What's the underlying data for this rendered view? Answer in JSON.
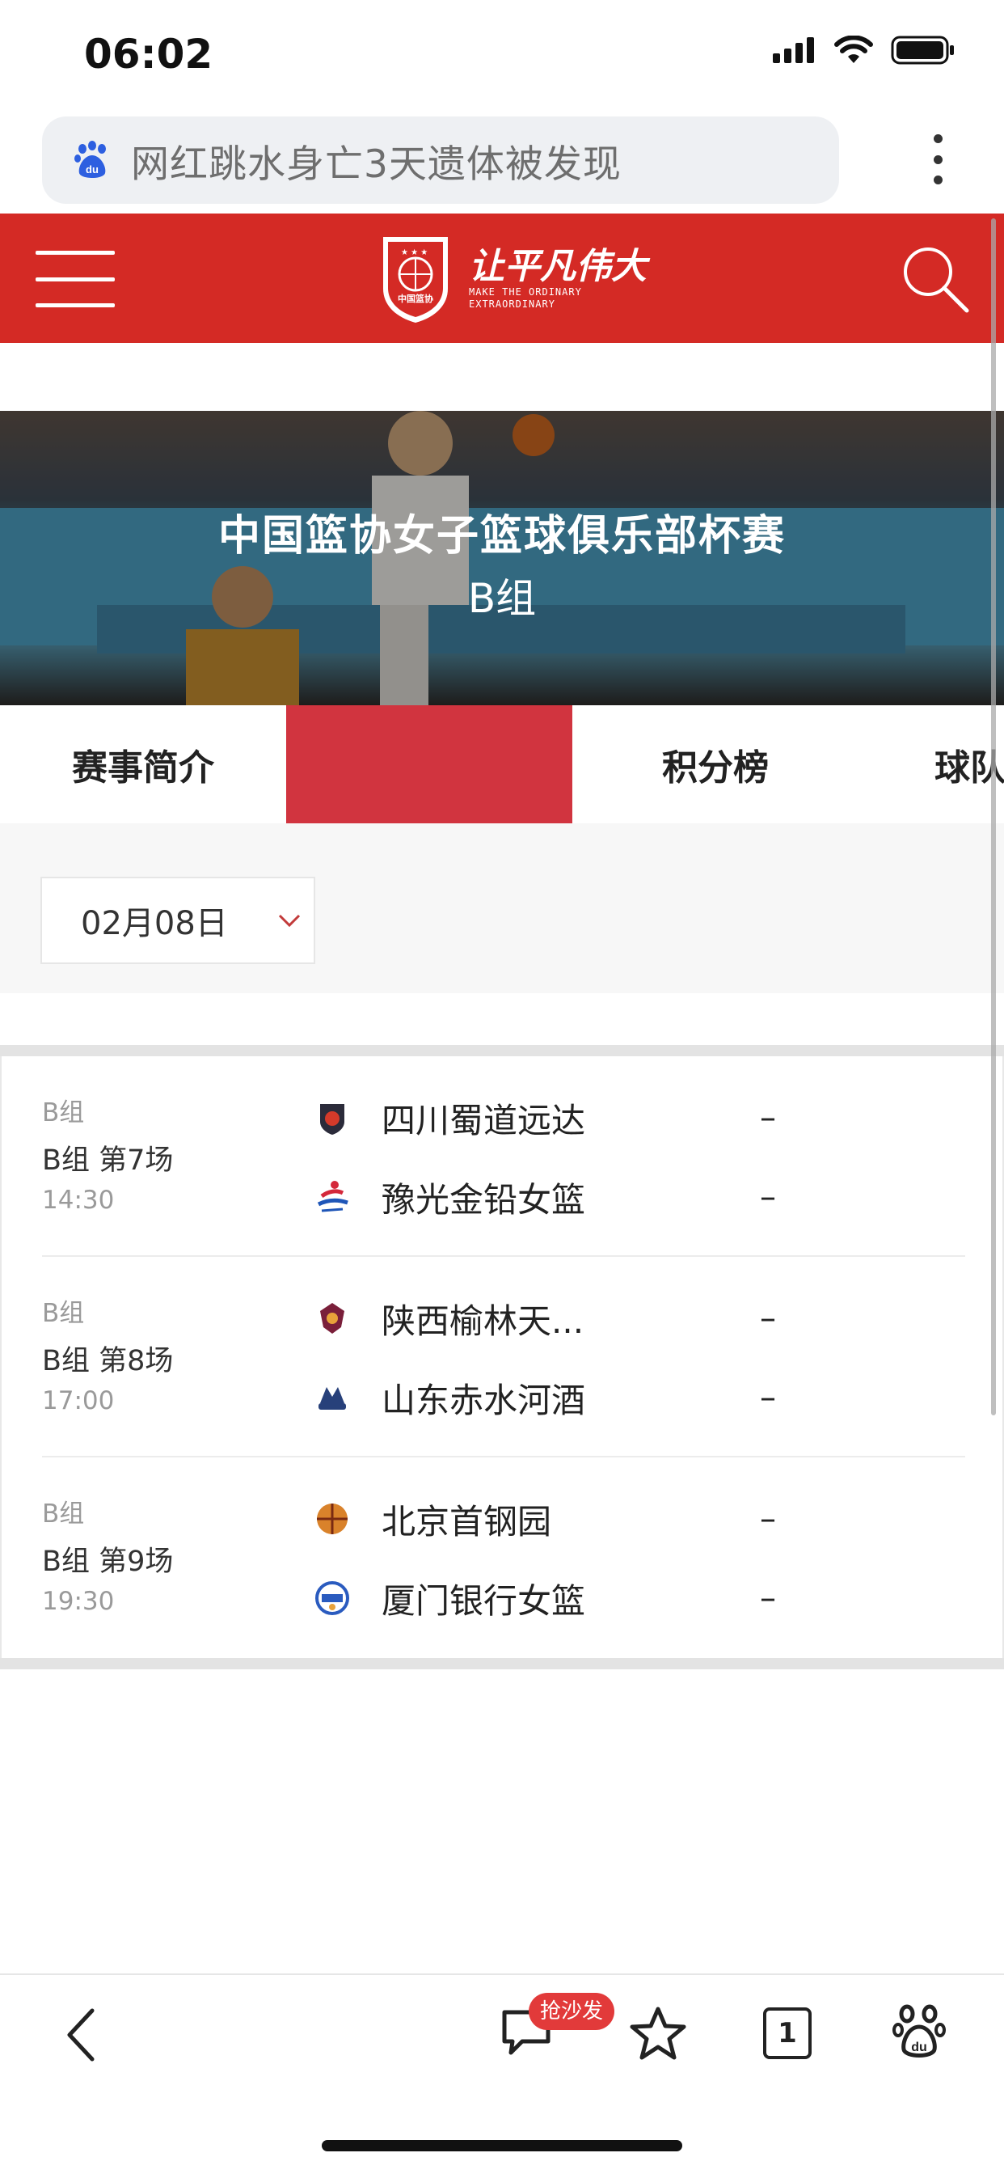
{
  "status_bar": {
    "time": "06:02",
    "icons": [
      "cellular-signal-icon",
      "wifi-icon",
      "battery-icon"
    ]
  },
  "browser": {
    "search_text": "网红跳水身亡3天遗体被发现",
    "icons": [
      "baidu-paw-icon",
      "more-vertical-icon"
    ]
  },
  "site_header": {
    "slogan": "让平凡伟大",
    "slogan_en_line1": "MAKE THE ORDINARY",
    "slogan_en_line2": "EXTRAORDINARY",
    "logo_text": "中国篮协",
    "brand_color": "#d42a25"
  },
  "banner": {
    "title": "中国篮协女子篮球俱乐部杯赛",
    "subtitle": "B组"
  },
  "tabs": [
    {
      "label": "赛事简介",
      "active": false
    },
    {
      "label": "",
      "active": true
    },
    {
      "label": "积分榜",
      "active": false
    },
    {
      "label": "球队",
      "active": false
    }
  ],
  "filter": {
    "date": "02月08日"
  },
  "matches": [
    {
      "group": "B组",
      "round": "B组 第7场",
      "time": "14:30",
      "home": {
        "name": "四川蜀道远达",
        "score": "–"
      },
      "away": {
        "name": "豫光金铅女篮",
        "score": "–"
      }
    },
    {
      "group": "B组",
      "round": "B组 第8场",
      "time": "17:00",
      "home": {
        "name": "陕西榆林天...",
        "score": "–"
      },
      "away": {
        "name": "山东赤水河酒",
        "score": "–"
      }
    },
    {
      "group": "B组",
      "round": "B组 第9场",
      "time": "19:30",
      "home": {
        "name": "北京首钢园",
        "score": "–"
      },
      "away": {
        "name": "厦门银行女篮",
        "score": "–"
      }
    }
  ],
  "toolbar": {
    "comment_badge": "抢沙发",
    "tab_count": "1",
    "icons": [
      "back-icon",
      "comment-icon",
      "star-icon",
      "tabs-icon",
      "baidu-paw-icon"
    ]
  }
}
